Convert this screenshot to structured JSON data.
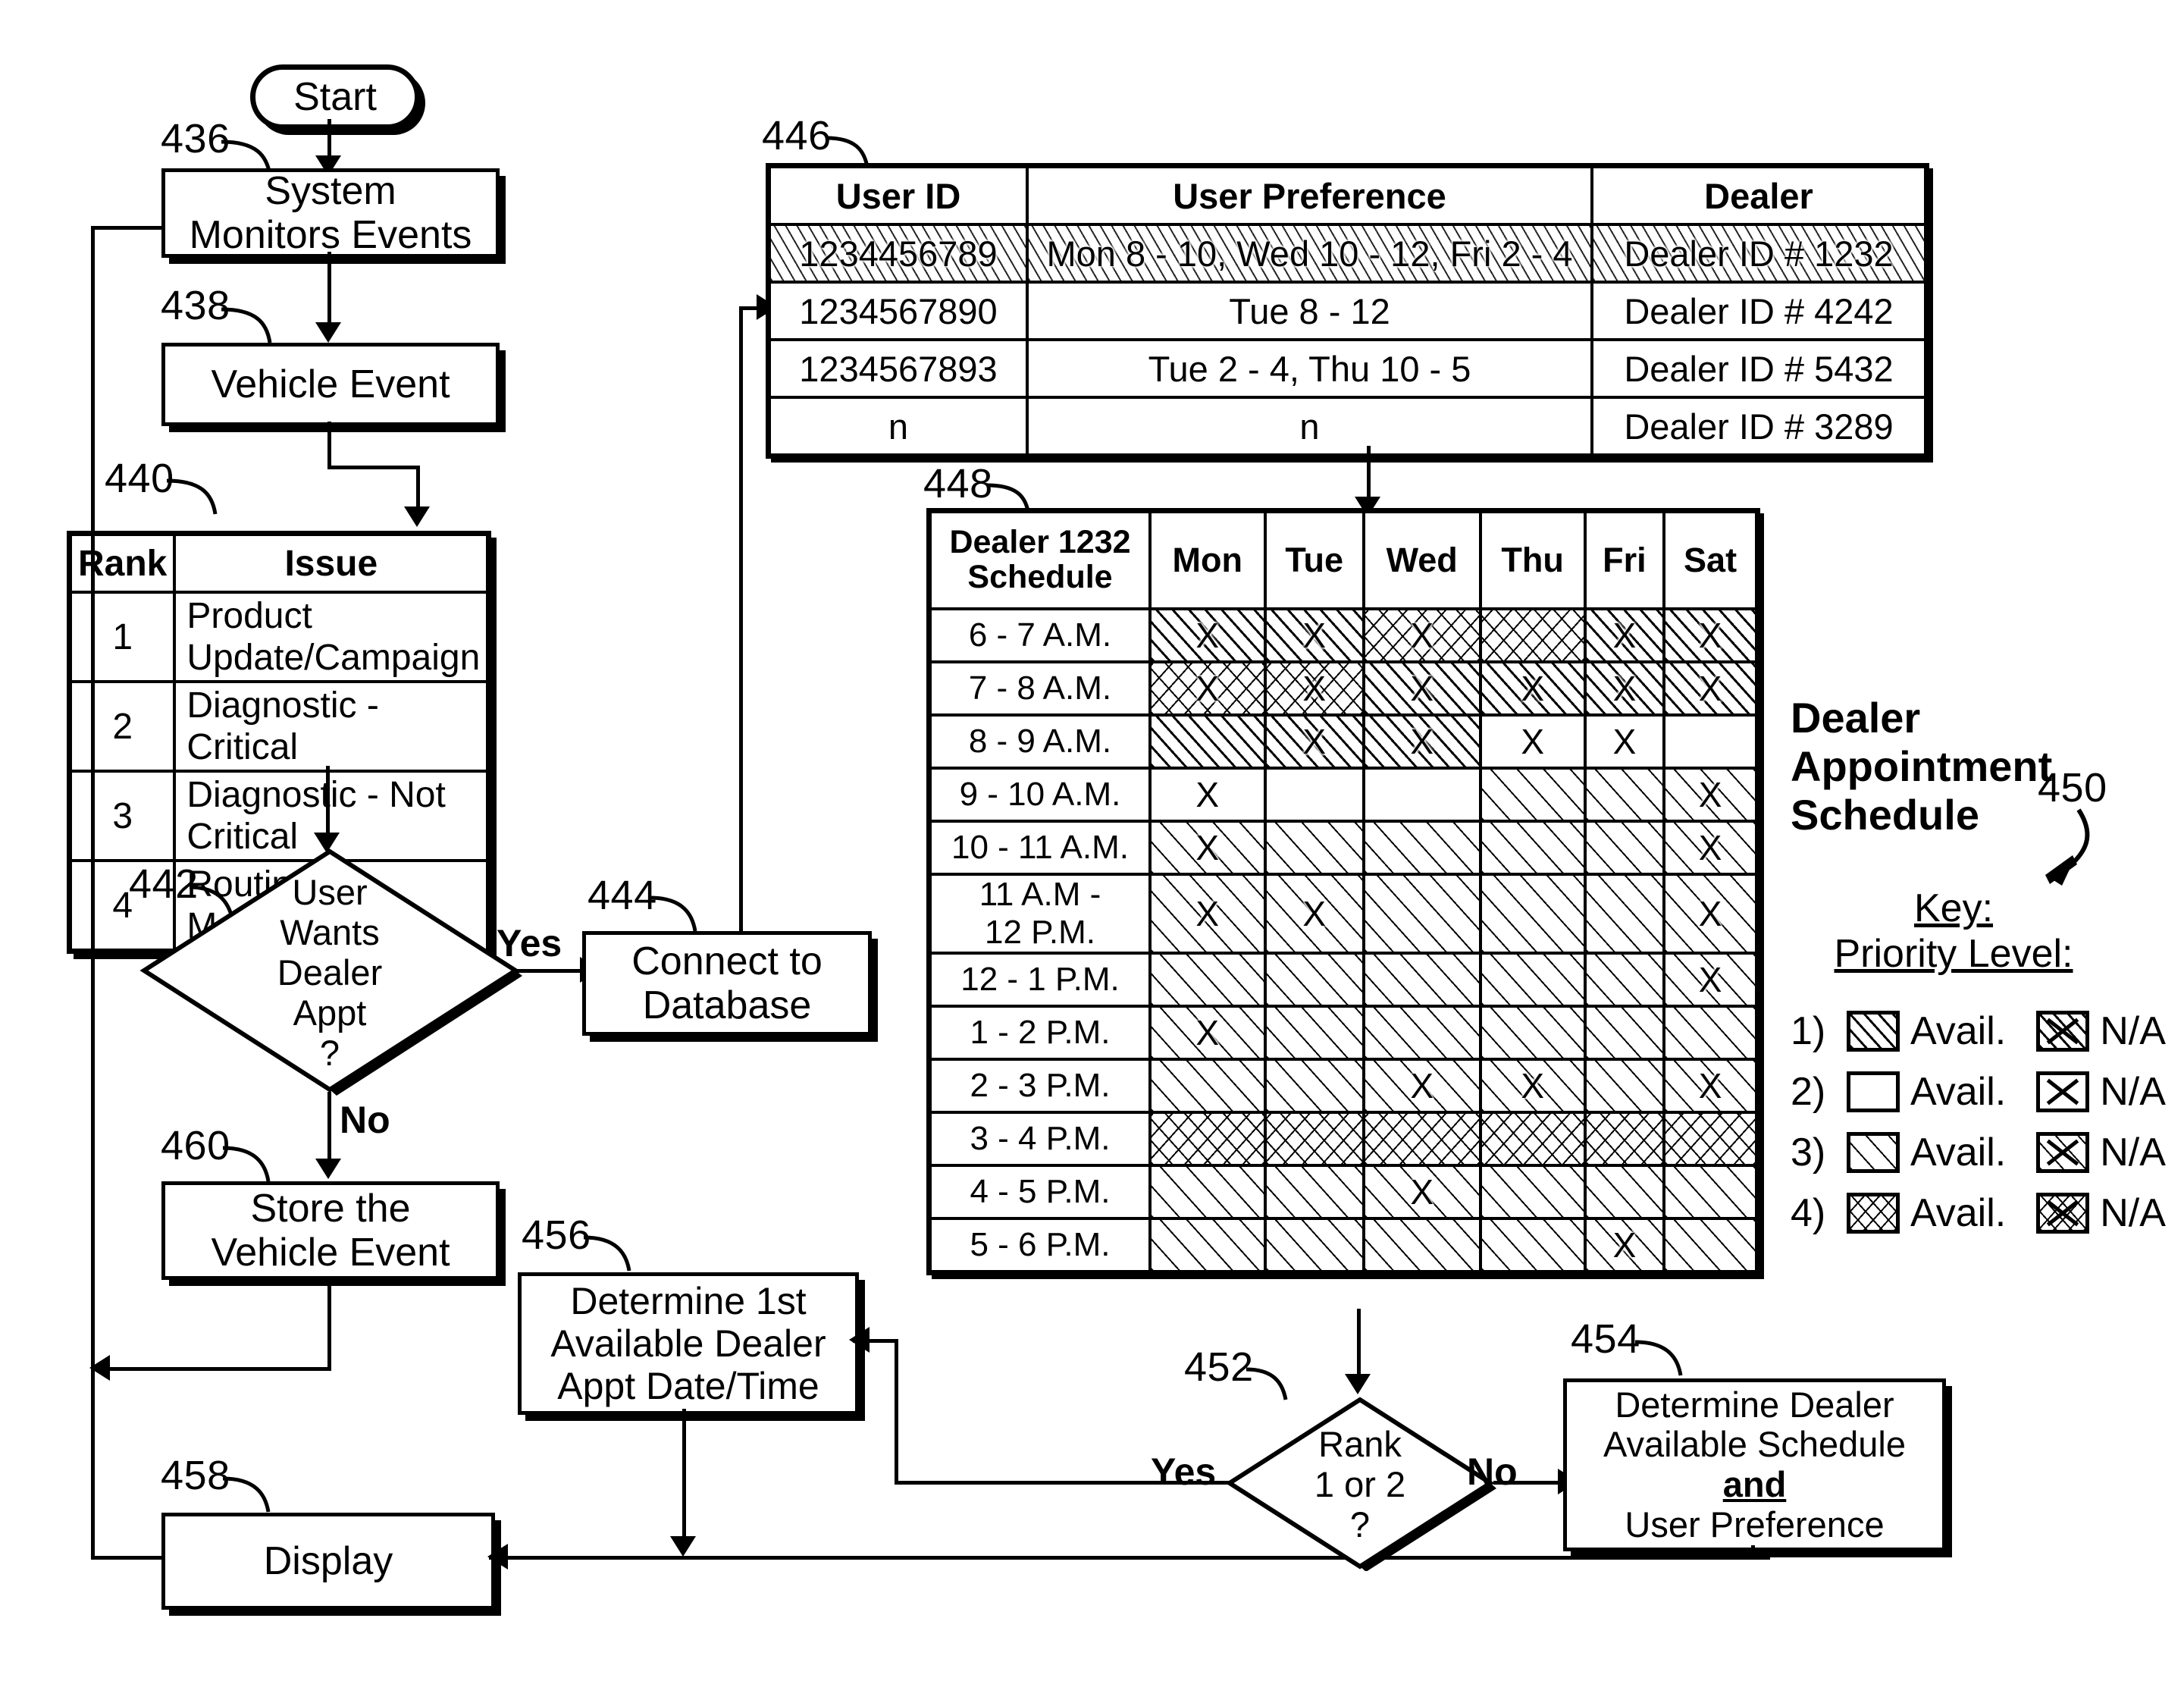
{
  "flow": {
    "start": "Start",
    "nodes": [
      {
        "ref": "436",
        "label": "System\nMonitors Events",
        "line1": "System",
        "line2": "Monitors Events"
      },
      {
        "ref": "438",
        "label": "Vehicle Event",
        "line1": "Vehicle Event",
        "line2": ""
      },
      {
        "ref": "444",
        "label": "Connect to Database",
        "line1": "Connect to",
        "line2": "Database"
      },
      {
        "ref": "460",
        "label": "Store the Vehicle Event",
        "line1": "Store the",
        "line2": "Vehicle Event"
      },
      {
        "ref": "456",
        "label": "Determine 1st Available Dealer Appt Date/Time",
        "line1": "Determine 1st",
        "line2": "Available Dealer",
        "line3": "Appt Date/Time"
      },
      {
        "ref": "454",
        "label": "Determine Dealer Available Schedule and User Preference",
        "line1": "Determine Dealer",
        "line2": "Available Schedule",
        "line3": "and",
        "line4": "User Preference"
      },
      {
        "ref": "458",
        "label": "Display",
        "line1": "Display",
        "line2": ""
      }
    ],
    "decisions": [
      {
        "ref": "442",
        "line1": "User",
        "line2": "Wants",
        "line3": "Dealer",
        "line4": "Appt",
        "line5": "?",
        "yes": "Yes",
        "no": "No"
      },
      {
        "ref": "452",
        "line1": "Rank",
        "line2": "1 or 2",
        "line3": "?",
        "yes": "Yes",
        "no": "No"
      }
    ],
    "edge_labels": {
      "yes1": "Yes",
      "no1": "No",
      "yes2": "Yes",
      "no2": "No"
    }
  },
  "rank_table": {
    "ref": "440",
    "headers": [
      "Rank",
      "Issue"
    ],
    "rows": [
      {
        "rank": "1",
        "issue": "Product Update/Campaign"
      },
      {
        "rank": "2",
        "issue": "Diagnostic - Critical"
      },
      {
        "rank": "3",
        "issue": "Diagnostic - Not Critical"
      },
      {
        "rank": "4",
        "issue": "Routine Maintenance"
      }
    ]
  },
  "user_table": {
    "ref": "446",
    "headers": [
      "User ID",
      "User Preference",
      "Dealer"
    ],
    "rows": [
      {
        "user_id": "1234456789",
        "preference": "Mon 8 - 10, Wed 10 - 12, Fri 2 - 4",
        "dealer": "Dealer ID # 1232",
        "highlighted": true
      },
      {
        "user_id": "1234567890",
        "preference": "Tue 8 - 12",
        "dealer": "Dealer ID # 4242",
        "highlighted": false
      },
      {
        "user_id": "1234567893",
        "preference": "Tue 2 - 4, Thu 10 - 5",
        "dealer": "Dealer ID # 5432",
        "highlighted": false
      },
      {
        "user_id": "n",
        "preference": "n",
        "dealer": "Dealer ID # 3289",
        "highlighted": false
      }
    ]
  },
  "schedule": {
    "ref": "448",
    "corner_line1": "Dealer 1232",
    "corner_line2": "Schedule",
    "days": [
      "Mon",
      "Tue",
      "Wed",
      "Thu",
      "Fri",
      "Sat"
    ],
    "times": [
      "6 - 7 A.M.",
      "7 - 8 A.M.",
      "8 - 9 A.M.",
      "9 - 10 A.M.",
      "10 - 11 A.M.",
      "11 A.M - 12 P.M.",
      "12 - 1 P.M.",
      "1 - 2 P.M.",
      "2 - 3 P.M.",
      "3 - 4 P.M.",
      "4 - 5 P.M.",
      "5 - 6 P.M."
    ],
    "time_lines": [
      [
        "6 - 7 A.M."
      ],
      [
        "7 - 8 A.M."
      ],
      [
        "8 - 9 A.M."
      ],
      [
        "9 - 10 A.M."
      ],
      [
        "10 - 11 A.M."
      ],
      [
        "11 A.M -",
        "12 P.M."
      ],
      [
        "12 - 1 P.M."
      ],
      [
        "1 - 2 P.M."
      ],
      [
        "2 - 3 P.M."
      ],
      [
        "3 - 4 P.M."
      ],
      [
        "4 - 5 P.M."
      ],
      [
        "5 - 6 P.M."
      ]
    ],
    "cells": [
      [
        {
          "p": 1,
          "x": true
        },
        {
          "p": 1,
          "x": true
        },
        {
          "p": 4,
          "x": true
        },
        {
          "p": 4,
          "x": false
        },
        {
          "p": 1,
          "x": true
        },
        {
          "p": 1,
          "x": true
        }
      ],
      [
        {
          "p": 4,
          "x": true
        },
        {
          "p": 4,
          "x": true
        },
        {
          "p": 1,
          "x": true
        },
        {
          "p": 1,
          "x": true
        },
        {
          "p": 1,
          "x": true
        },
        {
          "p": 1,
          "x": true
        }
      ],
      [
        {
          "p": 1,
          "x": false
        },
        {
          "p": 1,
          "x": true
        },
        {
          "p": 1,
          "x": true
        },
        {
          "p": 2,
          "x": true
        },
        {
          "p": 2,
          "x": true
        },
        {
          "p": 2,
          "x": false
        }
      ],
      [
        {
          "p": 2,
          "x": true
        },
        {
          "p": 2,
          "x": false
        },
        {
          "p": 2,
          "x": false
        },
        {
          "p": 3,
          "x": false
        },
        {
          "p": 3,
          "x": false
        },
        {
          "p": 3,
          "x": true
        }
      ],
      [
        {
          "p": 3,
          "x": true
        },
        {
          "p": 3,
          "x": false
        },
        {
          "p": 3,
          "x": false
        },
        {
          "p": 3,
          "x": false
        },
        {
          "p": 3,
          "x": false
        },
        {
          "p": 3,
          "x": true
        }
      ],
      [
        {
          "p": 3,
          "x": true
        },
        {
          "p": 3,
          "x": true
        },
        {
          "p": 3,
          "x": false
        },
        {
          "p": 3,
          "x": false
        },
        {
          "p": 3,
          "x": false
        },
        {
          "p": 3,
          "x": true
        }
      ],
      [
        {
          "p": 3,
          "x": false
        },
        {
          "p": 3,
          "x": false
        },
        {
          "p": 3,
          "x": false
        },
        {
          "p": 3,
          "x": false
        },
        {
          "p": 3,
          "x": false
        },
        {
          "p": 3,
          "x": true
        }
      ],
      [
        {
          "p": 3,
          "x": true
        },
        {
          "p": 3,
          "x": false
        },
        {
          "p": 3,
          "x": false
        },
        {
          "p": 3,
          "x": false
        },
        {
          "p": 3,
          "x": false
        },
        {
          "p": 3,
          "x": false
        }
      ],
      [
        {
          "p": 3,
          "x": false
        },
        {
          "p": 3,
          "x": false
        },
        {
          "p": 3,
          "x": true
        },
        {
          "p": 3,
          "x": true
        },
        {
          "p": 3,
          "x": false
        },
        {
          "p": 3,
          "x": true
        }
      ],
      [
        {
          "p": 4,
          "x": false
        },
        {
          "p": 4,
          "x": false
        },
        {
          "p": 4,
          "x": false
        },
        {
          "p": 4,
          "x": false
        },
        {
          "p": 4,
          "x": false
        },
        {
          "p": 4,
          "x": false
        }
      ],
      [
        {
          "p": 3,
          "x": false
        },
        {
          "p": 3,
          "x": false
        },
        {
          "p": 3,
          "x": true
        },
        {
          "p": 3,
          "x": false
        },
        {
          "p": 3,
          "x": false
        },
        {
          "p": 3,
          "x": false
        }
      ],
      [
        {
          "p": 3,
          "x": false
        },
        {
          "p": 3,
          "x": false
        },
        {
          "p": 3,
          "x": false
        },
        {
          "p": 3,
          "x": false
        },
        {
          "p": 3,
          "x": true
        },
        {
          "p": 3,
          "x": false
        }
      ]
    ]
  },
  "key": {
    "ref": "450",
    "title_line1": "Dealer",
    "title_line2": "Appointment",
    "title_line3": "Schedule",
    "head1": "Key:",
    "head2": "Priority Level:",
    "rows": [
      {
        "num": "1)",
        "avail": "Avail.",
        "na": "N/A"
      },
      {
        "num": "2)",
        "avail": "Avail.",
        "na": "N/A"
      },
      {
        "num": "3)",
        "avail": "Avail.",
        "na": "N/A"
      },
      {
        "num": "4)",
        "avail": "Avail.",
        "na": "N/A"
      }
    ]
  }
}
